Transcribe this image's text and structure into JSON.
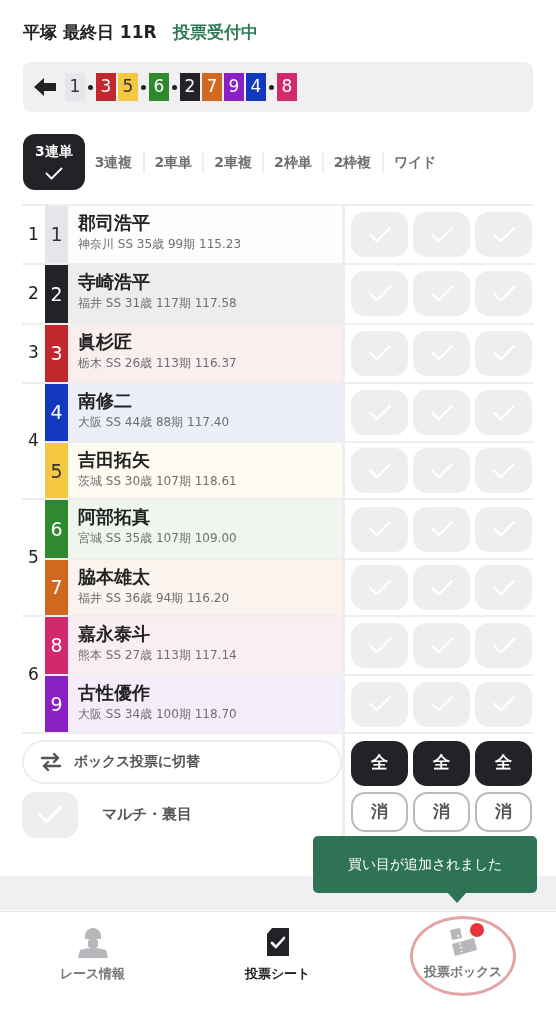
{
  "header": {
    "race": "平塚 最終日 11R",
    "status": "投票受付中"
  },
  "lineup": [
    {
      "bikes": [
        {
          "number": "1",
          "color": "#e5e5ea"
        }
      ]
    },
    {
      "bikes": [
        {
          "number": "3",
          "color": "#c0282d"
        },
        {
          "number": "5",
          "color": "#f5c842"
        }
      ]
    },
    {
      "bikes": [
        {
          "number": "6",
          "color": "#2f8a2f"
        }
      ]
    },
    {
      "bikes": [
        {
          "number": "2",
          "color": "#232327"
        },
        {
          "number": "7",
          "color": "#d0691f"
        },
        {
          "number": "9",
          "color": "#8a1fc4"
        },
        {
          "number": "4",
          "color": "#1338c0"
        }
      ]
    },
    {
      "bikes": [
        {
          "number": "8",
          "color": "#d2296e"
        }
      ]
    }
  ],
  "bet_types": [
    {
      "label": "3連単",
      "selected": true
    },
    {
      "label": "3連複",
      "selected": false
    },
    {
      "label": "2車単",
      "selected": false
    },
    {
      "label": "2車複",
      "selected": false
    },
    {
      "label": "2枠単",
      "selected": false
    },
    {
      "label": "2枠複",
      "selected": false
    },
    {
      "label": "ワイド",
      "selected": false
    }
  ],
  "frames": [
    {
      "number": "1",
      "riders": [
        {
          "number": "1",
          "color": "#e5e5ea",
          "name": "郡司浩平",
          "info": "神奈川 SS 35歳 99期 115.23",
          "picks": [
            {
              "checked": false
            },
            {
              "checked": false
            },
            {
              "checked": false
            }
          ]
        }
      ]
    },
    {
      "number": "2",
      "riders": [
        {
          "number": "2",
          "color": "#232327",
          "name": "寺崎浩平",
          "info": "福井 SS 31歳 117期 117.58",
          "picks": [
            {
              "checked": false
            },
            {
              "checked": false
            },
            {
              "checked": false
            }
          ]
        }
      ]
    },
    {
      "number": "3",
      "riders": [
        {
          "number": "3",
          "color": "#c0282d",
          "name": "眞杉匠",
          "info": "栃木 SS 26歳 113期 116.37",
          "picks": [
            {
              "checked": false
            },
            {
              "checked": false
            },
            {
              "checked": false
            }
          ]
        }
      ]
    },
    {
      "number": "4",
      "riders": [
        {
          "number": "4",
          "color": "#1338c0",
          "name": "南修二",
          "info": "大阪 SS 44歳 88期 117.40",
          "picks": [
            {
              "checked": false
            },
            {
              "checked": false
            },
            {
              "checked": false
            }
          ]
        },
        {
          "number": "5",
          "color": "#f5c842",
          "name": "吉田拓矢",
          "info": "茨城 SS 30歳 107期 118.61",
          "picks": [
            {
              "checked": false
            },
            {
              "checked": false
            },
            {
              "checked": false
            }
          ]
        }
      ]
    },
    {
      "number": "5",
      "riders": [
        {
          "number": "6",
          "color": "#2f8a2f",
          "name": "阿部拓真",
          "info": "宮城 SS 35歳 107期 109.00",
          "picks": [
            {
              "checked": false
            },
            {
              "checked": false
            },
            {
              "checked": false
            }
          ]
        },
        {
          "number": "7",
          "color": "#d0691f",
          "name": "脇本雄太",
          "info": "福井 SS 36歳 94期 116.20",
          "picks": [
            {
              "checked": false
            },
            {
              "checked": false
            },
            {
              "checked": false
            }
          ]
        }
      ]
    },
    {
      "number": "6",
      "riders": [
        {
          "number": "8",
          "color": "#d2296e",
          "name": "嘉永泰斗",
          "info": "熊本 SS 27歳 113期 117.14",
          "picks": [
            {
              "checked": false
            },
            {
              "checked": false
            },
            {
              "checked": false
            }
          ]
        },
        {
          "number": "9",
          "color": "#8a1fc4",
          "name": "古性優作",
          "info": "大阪 SS 34歳 100期 118.70",
          "picks": [
            {
              "checked": false
            },
            {
              "checked": false
            },
            {
              "checked": false
            }
          ]
        }
      ]
    }
  ],
  "box_switch": "ボックス投票に切替",
  "multi": {
    "label": "マルチ・裏目",
    "checked": false
  },
  "select_all": [
    "全",
    "全",
    "全"
  ],
  "clear": [
    "消",
    "消",
    "消"
  ],
  "toast": "買い目が追加されました",
  "nav": [
    {
      "kind": "rider",
      "label": "レース情報",
      "selected": false
    },
    {
      "kind": "sheet",
      "label": "投票シート",
      "selected": true
    },
    {
      "kind": "tickets",
      "label": "投票ボックス",
      "selected": false,
      "badge": true,
      "highlighted": true
    }
  ]
}
